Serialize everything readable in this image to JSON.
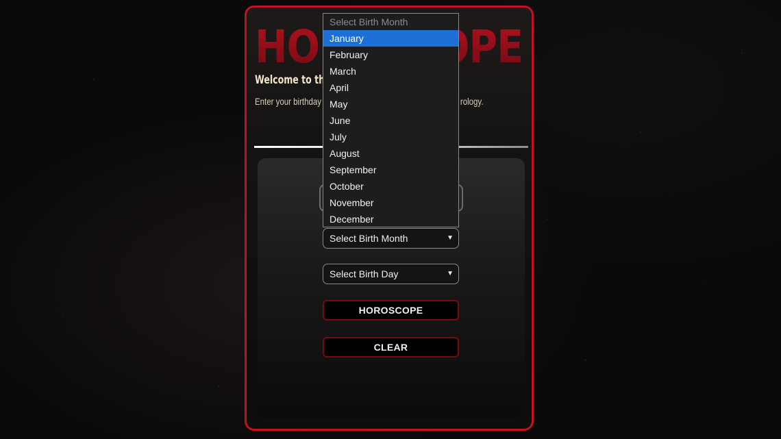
{
  "app": {
    "title": "HOROSCOPE",
    "welcome": "Welcome to the",
    "intro": "Enter your birthday                                   al your zodiac sign along with key pers                                              rology."
  },
  "form": {
    "month_select_label": "Select Birth Month",
    "day_select_label": "Select Birth Day",
    "horoscope_button": "HOROSCOPE",
    "clear_button": "CLEAR"
  },
  "month_dropdown": {
    "placeholder": "Select Birth Month",
    "selected": "January",
    "options": [
      "January",
      "February",
      "March",
      "April",
      "May",
      "June",
      "July",
      "August",
      "September",
      "October",
      "November",
      "December"
    ]
  },
  "icons": {
    "select_chevron": "chevron-down-icon"
  },
  "colors": {
    "accent": "#c1121f",
    "title_red": "#8a0a14",
    "highlight": "#1d6fd6"
  }
}
